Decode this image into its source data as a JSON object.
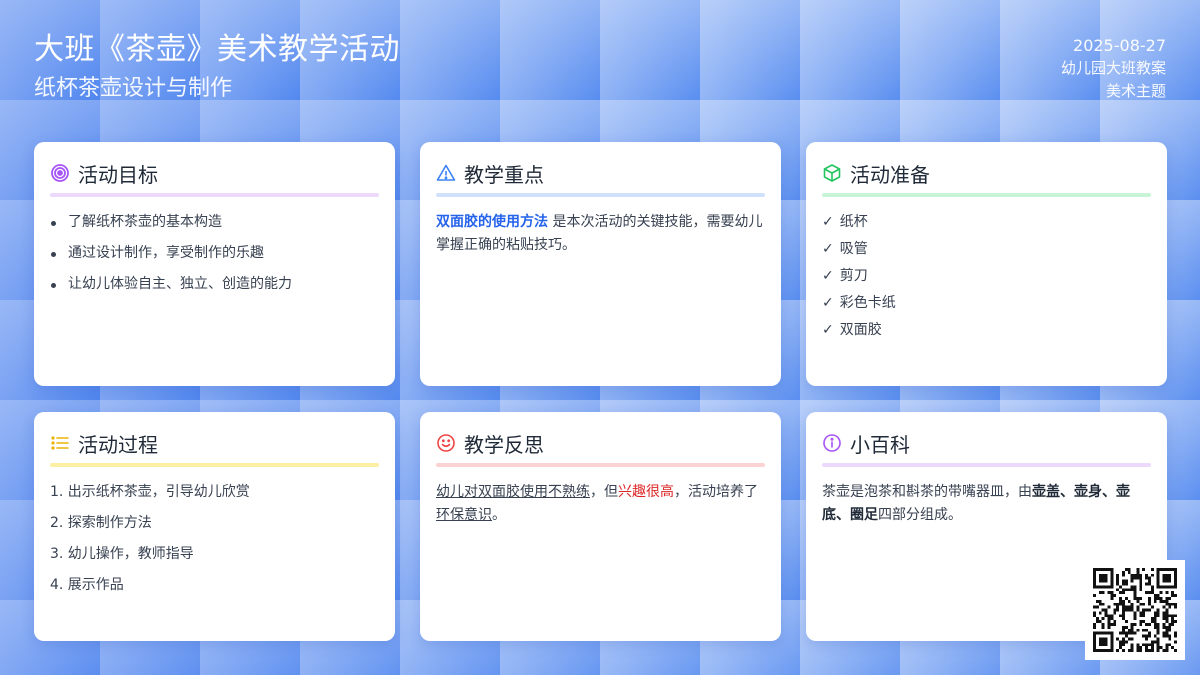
{
  "header": {
    "title": "大班《茶壶》美术教学活动",
    "subtitle": "纸杯茶壶设计与制作",
    "date": "2025-08-27",
    "grade": "幼儿园大班教案",
    "theme": "美术主题"
  },
  "cards": {
    "goals": {
      "title": "活动目标",
      "icon": "target-icon",
      "accent": "#a855f7",
      "items": [
        "了解纸杯茶壶的基本构造",
        "通过设计制作，享受制作的乐趣",
        "让幼儿体验自主、独立、创造的能力"
      ]
    },
    "focus": {
      "title": "教学重点",
      "icon": "warning-icon",
      "accent": "#3b82f6",
      "highlight": "双面胶的使用方法",
      "text": " 是本次活动的关键技能，需要幼儿掌握正确的粘贴技巧。"
    },
    "prep": {
      "title": "活动准备",
      "icon": "box-icon",
      "accent": "#22c55e",
      "check": "✓",
      "items": [
        "纸杯",
        "吸管",
        "剪刀",
        "彩色卡纸",
        "双面胶"
      ]
    },
    "process": {
      "title": "活动过程",
      "icon": "list-icon",
      "accent": "#eab308",
      "items": [
        "1. 出示纸杯茶壶，引导幼儿欣赏",
        "2. 探索制作方法",
        "3. 幼儿操作，教师指导",
        "4. 展示作品"
      ]
    },
    "reflection": {
      "title": "教学反思",
      "icon": "smile-icon",
      "accent": "#ef4444",
      "part1": "幼儿对双面胶使用不熟练",
      "part2": "，但",
      "part3": "兴趣很高",
      "part4": "，活动培养了",
      "part5": "环保意识",
      "part6": "。"
    },
    "wiki": {
      "title": "小百科",
      "icon": "info-icon",
      "accent": "#a855f7",
      "part1": "茶壶是泡茶和斟茶的带嘴器皿，由",
      "part2": "壶盖、壶身、壶底、圈足",
      "part3": "四部分组成。"
    }
  },
  "qr": {
    "icon": "qr-code-icon"
  }
}
